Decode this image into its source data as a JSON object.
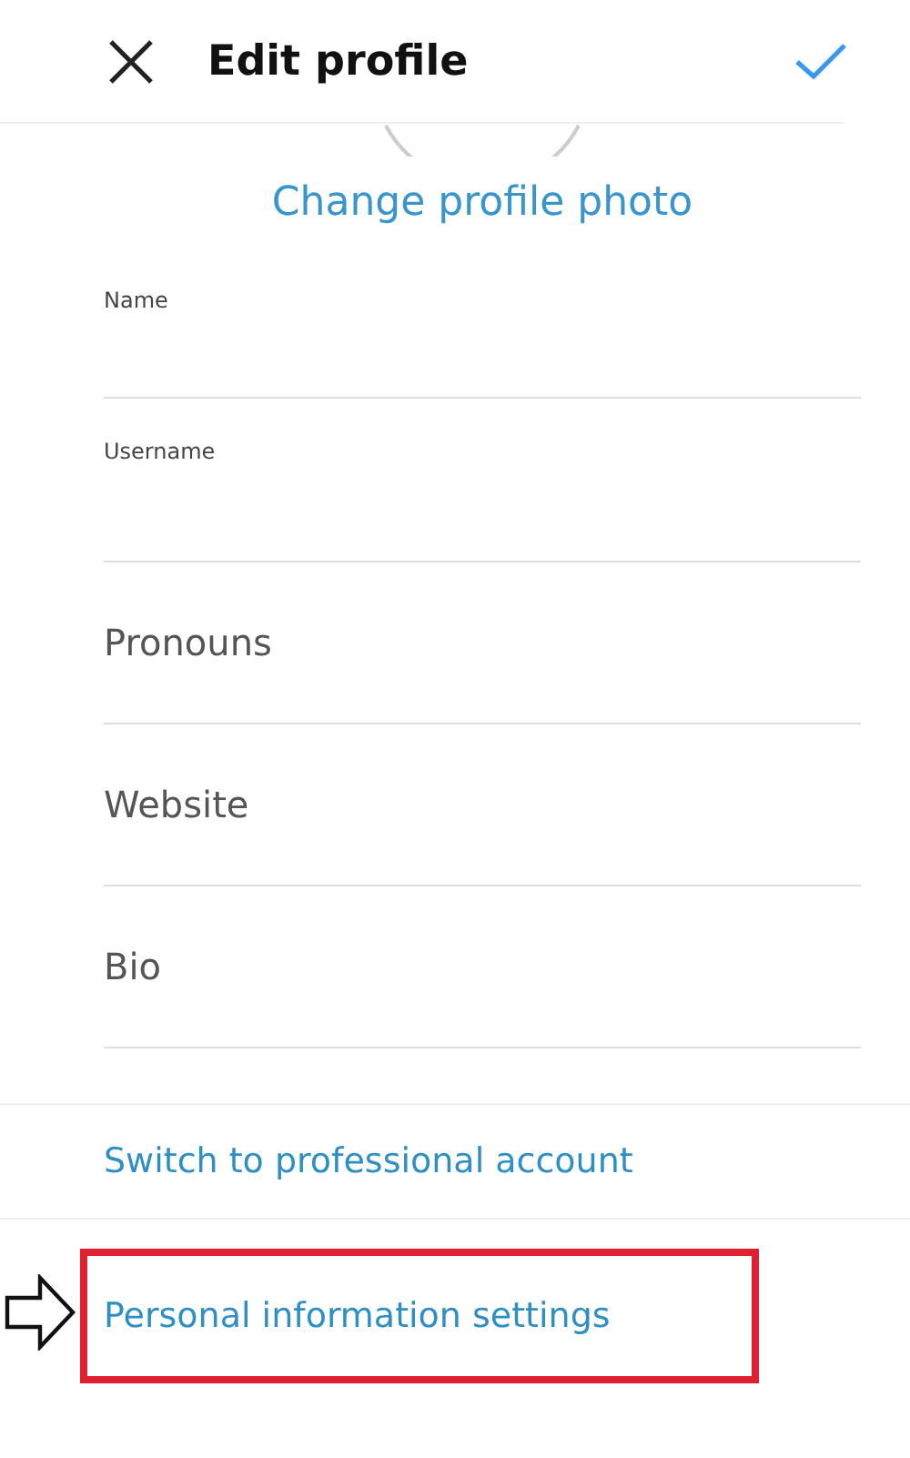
{
  "header": {
    "title": "Edit profile"
  },
  "change_photo": "Change profile photo",
  "fields": [
    {
      "kind": "labeled",
      "label": "Name"
    },
    {
      "kind": "labeled",
      "label": "Username"
    },
    {
      "kind": "placeholder",
      "placeholder": "Pronouns"
    },
    {
      "kind": "placeholder",
      "placeholder": "Website"
    },
    {
      "kind": "placeholder",
      "placeholder": "Bio"
    }
  ],
  "links": [
    {
      "label": "Switch to professional account",
      "highlighted": false
    },
    {
      "label": "Personal information settings",
      "highlighted": true
    }
  ]
}
